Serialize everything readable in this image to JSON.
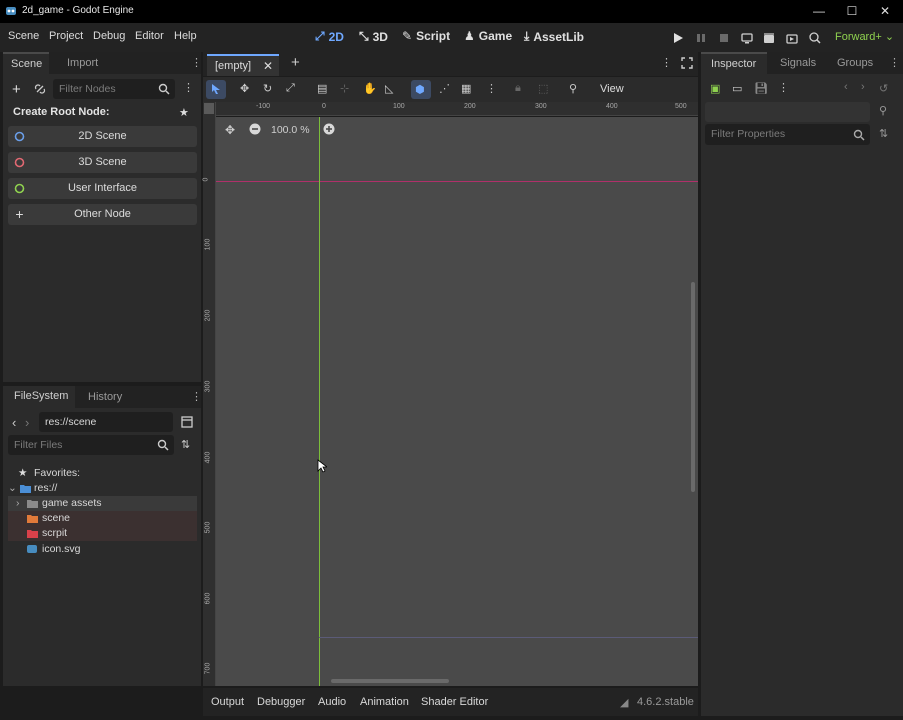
{
  "window": {
    "title": "2d_game - Godot Engine",
    "minimize": "—",
    "maximize": "☐",
    "close": "✕"
  },
  "menu": {
    "items": [
      "Scene",
      "Project",
      "Debug",
      "Editor",
      "Help"
    ]
  },
  "main_tabs": [
    "2D",
    "3D",
    "Script",
    "Game",
    "AssetLib"
  ],
  "renderer": "Forward+",
  "scene_dock": {
    "tabs": [
      "Scene",
      "Import"
    ],
    "filter_placeholder": "Filter Nodes",
    "create_root_label": "Create Root Node:",
    "root_buttons": [
      "2D Scene",
      "3D Scene",
      "User Interface",
      "Other Node"
    ]
  },
  "filesystem": {
    "tabs": [
      "FileSystem",
      "History"
    ],
    "path": "res://scene",
    "filter_placeholder": "Filter Files",
    "favorites_label": "Favorites:",
    "root": "res://",
    "items": [
      "game assets",
      "scene",
      "scrpit",
      "icon.svg"
    ]
  },
  "editor": {
    "tab_label": "[empty]",
    "view_label": "View",
    "zoom": "100.0 %",
    "ruler_h": [
      "-100",
      "0",
      "100",
      "200",
      "300",
      "400",
      "500"
    ],
    "ruler_v": [
      "0",
      "100",
      "200",
      "300",
      "400",
      "500",
      "600",
      "700"
    ]
  },
  "bottom_panel": {
    "tabs": [
      "Output",
      "Debugger",
      "Audio",
      "Animation",
      "Shader Editor"
    ],
    "version": "4.6.2.stable"
  },
  "inspector": {
    "tabs": [
      "Inspector",
      "Signals",
      "Groups"
    ],
    "filter_placeholder": "Filter Properties"
  },
  "colors": {
    "accent": "#6fa8ff",
    "canvas": "#4a4a4a",
    "panel": "#2b2b2b",
    "x_axis": "#b0306a",
    "y_axis": "#7cbf3a",
    "folder_orange": "#e07a3a",
    "folder_red": "#d9414a",
    "folder_blue": "#4b8fd6"
  }
}
